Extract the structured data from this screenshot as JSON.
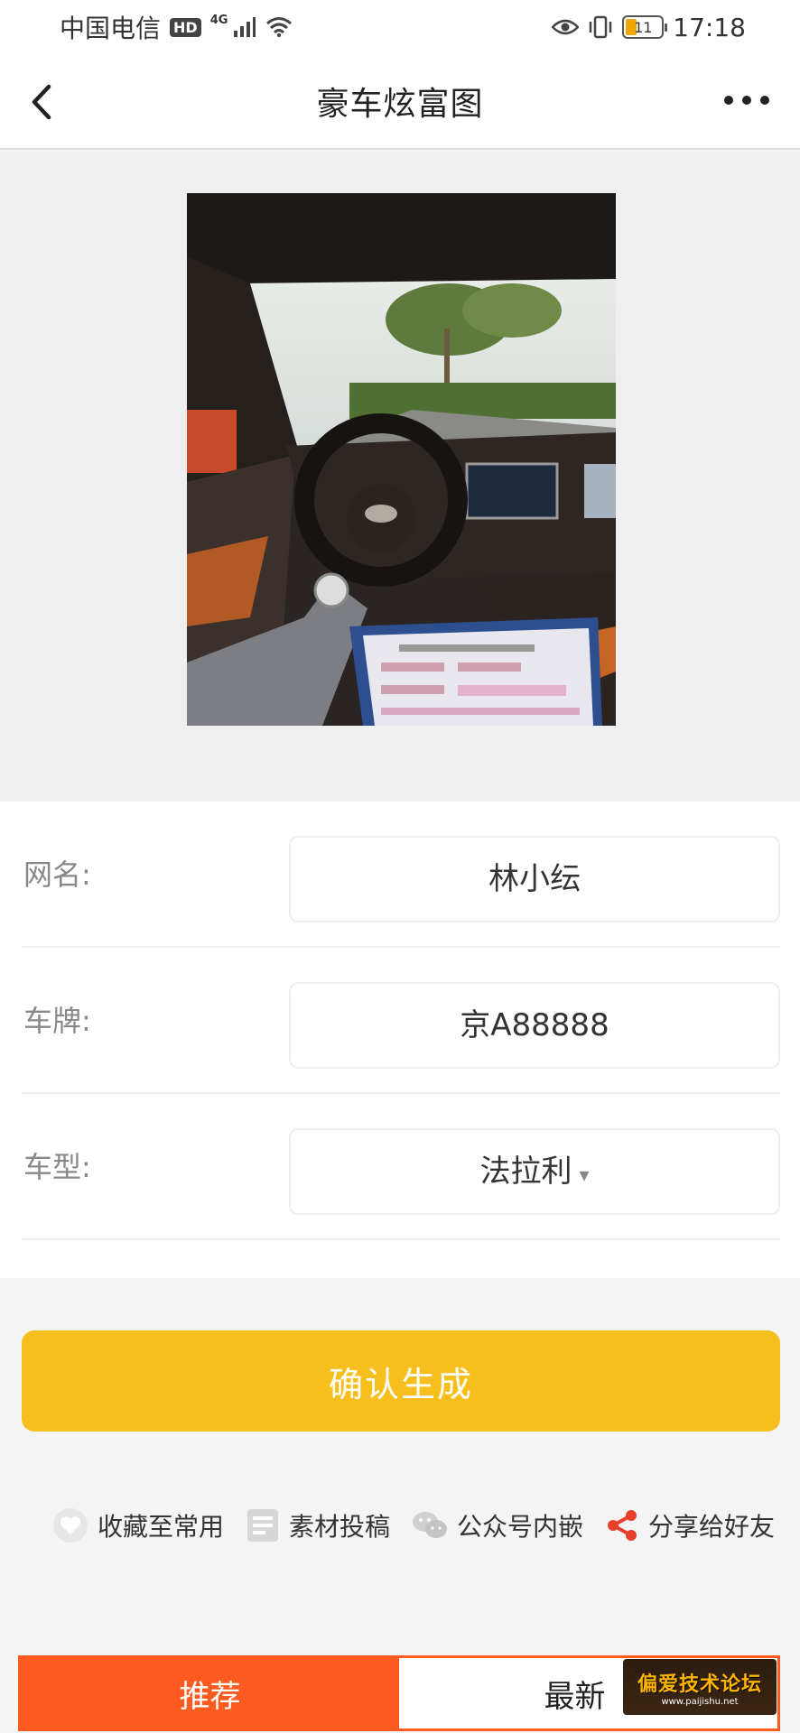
{
  "status_bar": {
    "carrier": "中国电信",
    "hd": "HD",
    "network": "4G",
    "battery": "11",
    "time": "17:18"
  },
  "header": {
    "title": "豪车炫富图"
  },
  "form": {
    "name": {
      "label": "网名:",
      "value": "林小纭"
    },
    "plate": {
      "label": "车牌:",
      "value": "京A88888"
    },
    "model": {
      "label": "车型:",
      "value": "法拉利",
      "caret": "▾"
    }
  },
  "generate_button": "确认生成",
  "actions": [
    {
      "label": "收藏至常用",
      "icon": "heart-icon"
    },
    {
      "label": "素材投稿",
      "icon": "document-icon"
    },
    {
      "label": "公众号内嵌",
      "icon": "wechat-icon"
    },
    {
      "label": "分享给好友",
      "icon": "share-icon"
    }
  ],
  "tabs": {
    "recommend": "推荐",
    "latest": "最新"
  },
  "watermark": {
    "line1": "偏爱技术论坛",
    "line2": "www.paijishu.net"
  },
  "colors": {
    "accent_orange": "#ff5a1f",
    "button_yellow": "#f6bf1d",
    "share_red": "#e8402b"
  }
}
